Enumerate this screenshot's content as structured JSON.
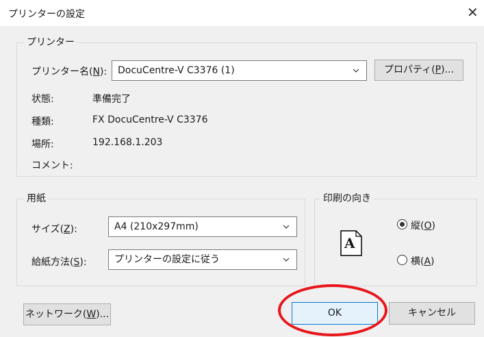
{
  "dialog": {
    "title": "プリンターの設定"
  },
  "printer_group": {
    "legend": "プリンター",
    "name_label": "プリンター名(",
    "name_label_key": "N",
    "name_label_end": "):",
    "name_value": "DocuCentre-V C3376 (1)",
    "properties_label": "プロパティ(",
    "properties_key": "P",
    "properties_end": ")...",
    "status_label": "状態:",
    "status_value": "準備完了",
    "type_label": "種類:",
    "type_value": "FX DocuCentre-V C3376",
    "location_label": "場所:",
    "location_value": "192.168.1.203",
    "comment_label": "コメント:",
    "comment_value": ""
  },
  "paper_group": {
    "legend": "用紙",
    "size_label": "サイズ(",
    "size_key": "Z",
    "size_end": "):",
    "size_value": "A4 (210x297mm)",
    "source_label": "給紙方法(",
    "source_key": "S",
    "source_end": "):",
    "source_value": "プリンターの設定に従う"
  },
  "orientation_group": {
    "legend": "印刷の向き",
    "portrait_label": "縦(",
    "portrait_key": "O",
    "portrait_end": ")",
    "landscape_label": "横(",
    "landscape_key": "A",
    "landscape_end": ")",
    "selected": "portrait",
    "page_glyph": "A"
  },
  "buttons": {
    "network_label": "ネットワーク(",
    "network_key": "W",
    "network_end": ")...",
    "ok_label": "OK",
    "cancel_label": "キャンセル"
  },
  "colors": {
    "accent": "#0078d7",
    "highlight": "#e8151b"
  },
  "icons": {
    "close": "close-icon",
    "dropdown": "chevron-down-icon",
    "radio": "radio-icon"
  }
}
